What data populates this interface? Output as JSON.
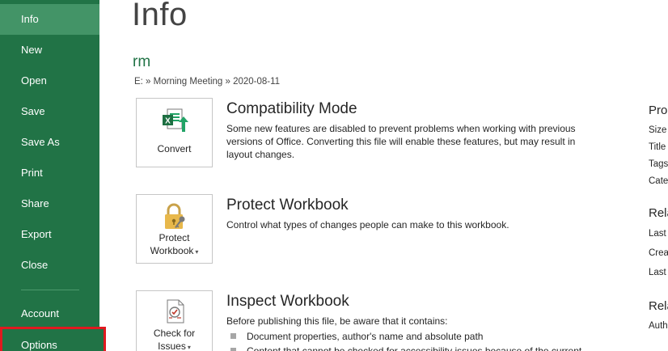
{
  "sidebar": {
    "items": [
      {
        "label": "Info"
      },
      {
        "label": "New"
      },
      {
        "label": "Open"
      },
      {
        "label": "Save"
      },
      {
        "label": "Save As"
      },
      {
        "label": "Print"
      },
      {
        "label": "Share"
      },
      {
        "label": "Export"
      },
      {
        "label": "Close"
      },
      {
        "label": "Account"
      },
      {
        "label": "Options"
      }
    ],
    "active_item": "Info",
    "highlighted_item": "Options"
  },
  "main": {
    "title": "Info",
    "document_name": "rm",
    "breadcrumb": "E: » Morning Meeting » 2020-08-11",
    "sections": [
      {
        "button_label_line1": "Convert",
        "button_label_line2": "",
        "icon": "excel-convert-icon",
        "title": "Compatibility Mode",
        "description": "Some new features are disabled to prevent problems when working with previous versions of Office. Converting this file will enable these features, but may result in layout changes."
      },
      {
        "button_label_line1": "Protect",
        "button_label_line2": "Workbook",
        "icon": "lock-key-icon",
        "title": "Protect Workbook",
        "description": "Control what types of changes people can make to this workbook."
      },
      {
        "button_label_line1": "Check for",
        "button_label_line2": "Issues",
        "icon": "inspect-document-icon",
        "title": "Inspect Workbook",
        "description": "Before publishing this file, be aware that it contains:",
        "bullets": [
          "Document properties, author's name and absolute path",
          "Content that cannot be checked for accessibility issues because of the current"
        ]
      }
    ]
  },
  "properties": {
    "header1": "Prop",
    "rows1": [
      "Size",
      "Title",
      "Tags",
      "Cate"
    ],
    "header2": "Rela",
    "rows2": [
      "Last",
      "Creat",
      "Last"
    ],
    "header3": "Rela",
    "rows3": [
      "Auth"
    ]
  },
  "colors": {
    "sidebar_bg": "#217346",
    "sidebar_active": "#439467",
    "options_highlight_border": "#e0191f",
    "doc_name": "#217346"
  }
}
